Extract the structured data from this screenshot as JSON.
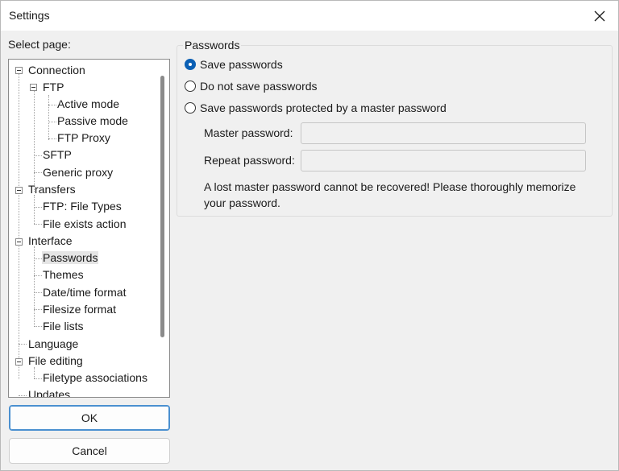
{
  "window": {
    "title": "Settings"
  },
  "sidebar": {
    "label": "Select page:",
    "tree": [
      {
        "label": "Connection",
        "expanded": true
      },
      {
        "label": "FTP",
        "expanded": true
      },
      {
        "label": "Active mode"
      },
      {
        "label": "Passive mode"
      },
      {
        "label": "FTP Proxy"
      },
      {
        "label": "SFTP"
      },
      {
        "label": "Generic proxy"
      },
      {
        "label": "Transfers",
        "expanded": true
      },
      {
        "label": "FTP: File Types"
      },
      {
        "label": "File exists action"
      },
      {
        "label": "Interface",
        "expanded": true
      },
      {
        "label": "Passwords",
        "selected": true
      },
      {
        "label": "Themes"
      },
      {
        "label": "Date/time format"
      },
      {
        "label": "Filesize format"
      },
      {
        "label": "File lists"
      },
      {
        "label": "Language"
      },
      {
        "label": "File editing",
        "expanded": true
      },
      {
        "label": "Filetype associations"
      },
      {
        "label": "Updates"
      }
    ]
  },
  "buttons": {
    "ok": "OK",
    "cancel": "Cancel"
  },
  "passwords": {
    "group_title": "Passwords",
    "options": [
      {
        "label": "Save passwords",
        "checked": true
      },
      {
        "label": "Do not save passwords",
        "checked": false
      },
      {
        "label": "Save passwords protected by a master password",
        "checked": false
      }
    ],
    "master_label": "Master password:",
    "master_value": "",
    "repeat_label": "Repeat password:",
    "repeat_value": "",
    "note": "A lost master password cannot be recovered! Please thoroughly memorize your password."
  },
  "colors": {
    "accent": "#0a5fb4",
    "default_button_border": "#4a90d0"
  }
}
